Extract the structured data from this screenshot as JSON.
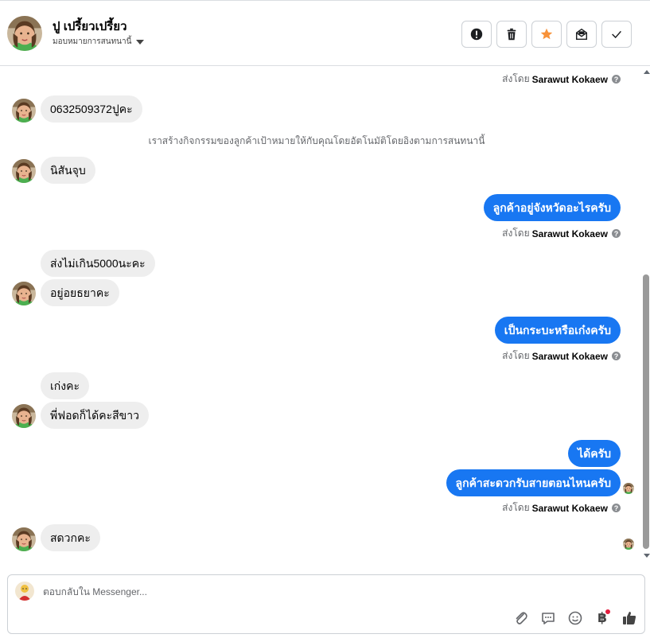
{
  "header": {
    "contact_name": "ปู เปรี้ยวเปรี้ยว",
    "assign_label": "มอบหมายการสนทนานี้"
  },
  "actions": [
    {
      "name": "mark-spam-button",
      "icon": "alert-icon"
    },
    {
      "name": "delete-button",
      "icon": "trash-icon"
    },
    {
      "name": "star-button",
      "icon": "star-icon"
    },
    {
      "name": "mark-unread-button",
      "icon": "envelope-icon"
    },
    {
      "name": "mark-done-button",
      "icon": "check-icon"
    }
  ],
  "thread": {
    "sent_by_prefix": "ส่งโดย",
    "sender": "Sarawut Kokaew",
    "system_note": "เราสร้างกิจกรรมของลูกค้าเป้าหมายให้กับคุณโดยอัตโนมัติโดยอิงตามการสนทนานี้",
    "messages": [
      {
        "dir": "in",
        "text": "0632509372ปูคะ"
      },
      {
        "dir": "in",
        "text": "นิสันจุบ"
      },
      {
        "dir": "out",
        "text": "ลูกค้าอยู่จังหวัดอะไรครับ"
      },
      {
        "dir": "in",
        "text": "ส่งไม่เกิน5000นะคะ"
      },
      {
        "dir": "in",
        "text": "อยู่อยธยาคะ"
      },
      {
        "dir": "out",
        "text": "เป็นกระบะหรือเก๋งครับ"
      },
      {
        "dir": "in",
        "text": "เก่งคะ"
      },
      {
        "dir": "in",
        "text": "พี่ฟอดก็ได้คะสีขาว"
      },
      {
        "dir": "out",
        "text": "ได้ครับ"
      },
      {
        "dir": "out",
        "text": "ลูกค้าสะดวกรับสายตอนไหนครับ"
      },
      {
        "dir": "in",
        "text": "สดวกคะ"
      }
    ]
  },
  "composer": {
    "placeholder": "ตอบกลับใน Messenger...",
    "baht_symbol": "฿"
  },
  "colors": {
    "brand_blue": "#1877f2",
    "incoming_bubble": "#eeeeee",
    "star_orange": "#f7923a"
  }
}
